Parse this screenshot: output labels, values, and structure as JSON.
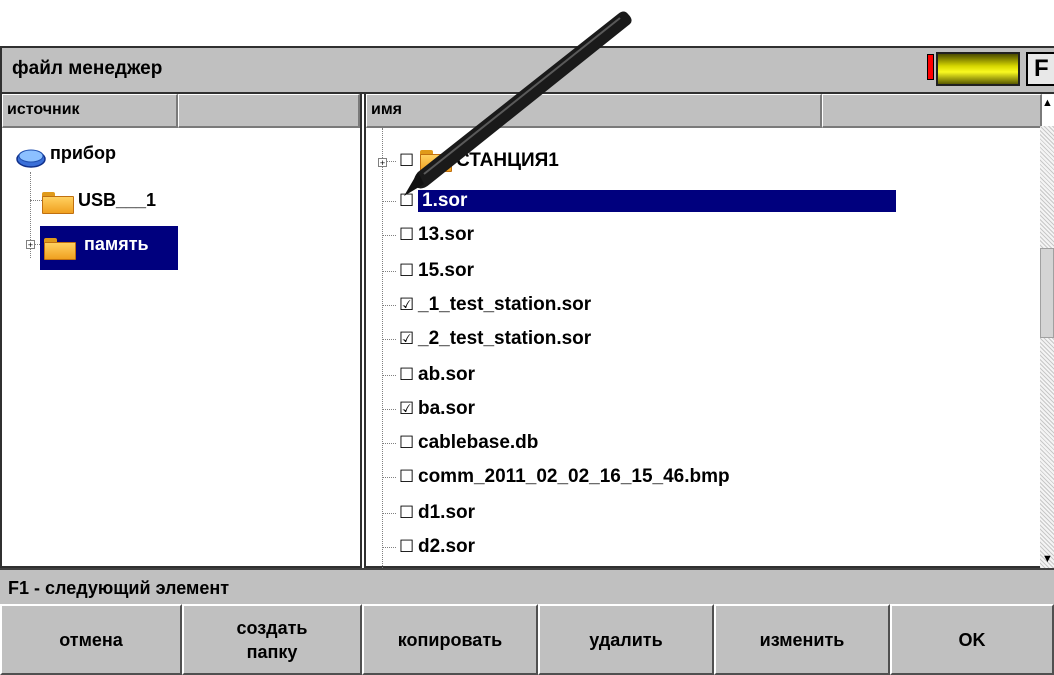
{
  "window": {
    "title": "файл менеджер",
    "function_key_label": "F"
  },
  "colors": {
    "selection": "#00007e",
    "battery": "#e0e000",
    "battery_low": "#ff0000"
  },
  "left_pane": {
    "headers": [
      "источник",
      ""
    ],
    "tree": [
      {
        "label": "прибор",
        "icon": "device-icon",
        "level": 0
      },
      {
        "label": "USB___1",
        "icon": "folder-icon",
        "level": 1
      },
      {
        "label": "память",
        "icon": "folder-icon",
        "level": 1,
        "selected": true,
        "expandable": true
      }
    ]
  },
  "right_pane": {
    "headers": [
      "имя",
      ""
    ],
    "files": [
      {
        "name": "СТАНЦИЯ1",
        "checked": false,
        "folder": true,
        "expandable": true
      },
      {
        "name": "1.sor",
        "checked": false,
        "selected": true
      },
      {
        "name": "13.sor",
        "checked": false
      },
      {
        "name": "15.sor",
        "checked": false
      },
      {
        "name": "_1_test_station.sor",
        "checked": true
      },
      {
        "name": "_2_test_station.sor",
        "checked": true
      },
      {
        "name": "ab.sor",
        "checked": false
      },
      {
        "name": "ba.sor",
        "checked": true
      },
      {
        "name": "cablebase.db",
        "checked": false
      },
      {
        "name": "comm_2011_02_02_16_15_46.bmp",
        "checked": false
      },
      {
        "name": "d1.sor",
        "checked": false
      },
      {
        "name": "d2.sor",
        "checked": false
      }
    ]
  },
  "status": {
    "text": "F1 - следующий элемент"
  },
  "buttons": [
    {
      "label": "отмена"
    },
    {
      "label": "создать\nпапку"
    },
    {
      "label": "копировать"
    },
    {
      "label": "удалить"
    },
    {
      "label": "изменить"
    },
    {
      "label": "OK"
    }
  ]
}
